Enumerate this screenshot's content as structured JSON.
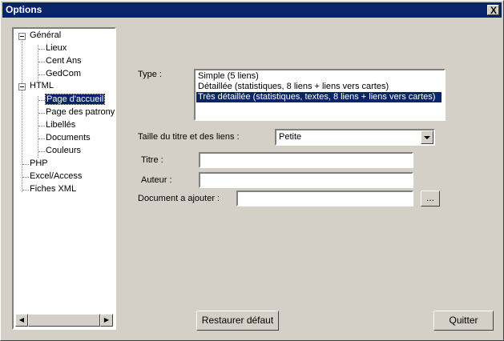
{
  "window": {
    "title": "Options",
    "close_glyph": "X"
  },
  "tree": {
    "items": [
      {
        "label": "Général"
      },
      {
        "label": "Lieux"
      },
      {
        "label": "Cent Ans"
      },
      {
        "label": "GedCom"
      },
      {
        "label": "HTML"
      },
      {
        "label": "Page d'accueil"
      },
      {
        "label": "Page des patronymes"
      },
      {
        "label": "Libellés"
      },
      {
        "label": "Documents"
      },
      {
        "label": "Couleurs"
      },
      {
        "label": "PHP"
      },
      {
        "label": "Excel/Access"
      },
      {
        "label": "Fiches XML"
      }
    ],
    "selected": "Page d'accueil"
  },
  "form": {
    "type_label": "Type :",
    "type_options": [
      "Simple (5 liens)",
      "Détaillée (statistiques, 8 liens + liens vers cartes)",
      "Très détaillée (statistiques, textes, 8 liens + liens vers cartes)"
    ],
    "type_selected": "Très détaillée (statistiques, textes, 8 liens + liens vers cartes)",
    "size_label": "Taille du titre et des liens :",
    "size_value": "Petite",
    "title_label": "Titre :",
    "title_value": "",
    "author_label": "Auteur :",
    "author_value": "",
    "document_label": "Document a ajouter :",
    "document_value": "",
    "browse_label": "..."
  },
  "buttons": {
    "restore_label": "Restaurer défaut",
    "quit_label": "Quitter"
  },
  "colors": {
    "face": "#d4d0c8",
    "title_bar": "#0a246a",
    "selection": "#0a246a"
  }
}
